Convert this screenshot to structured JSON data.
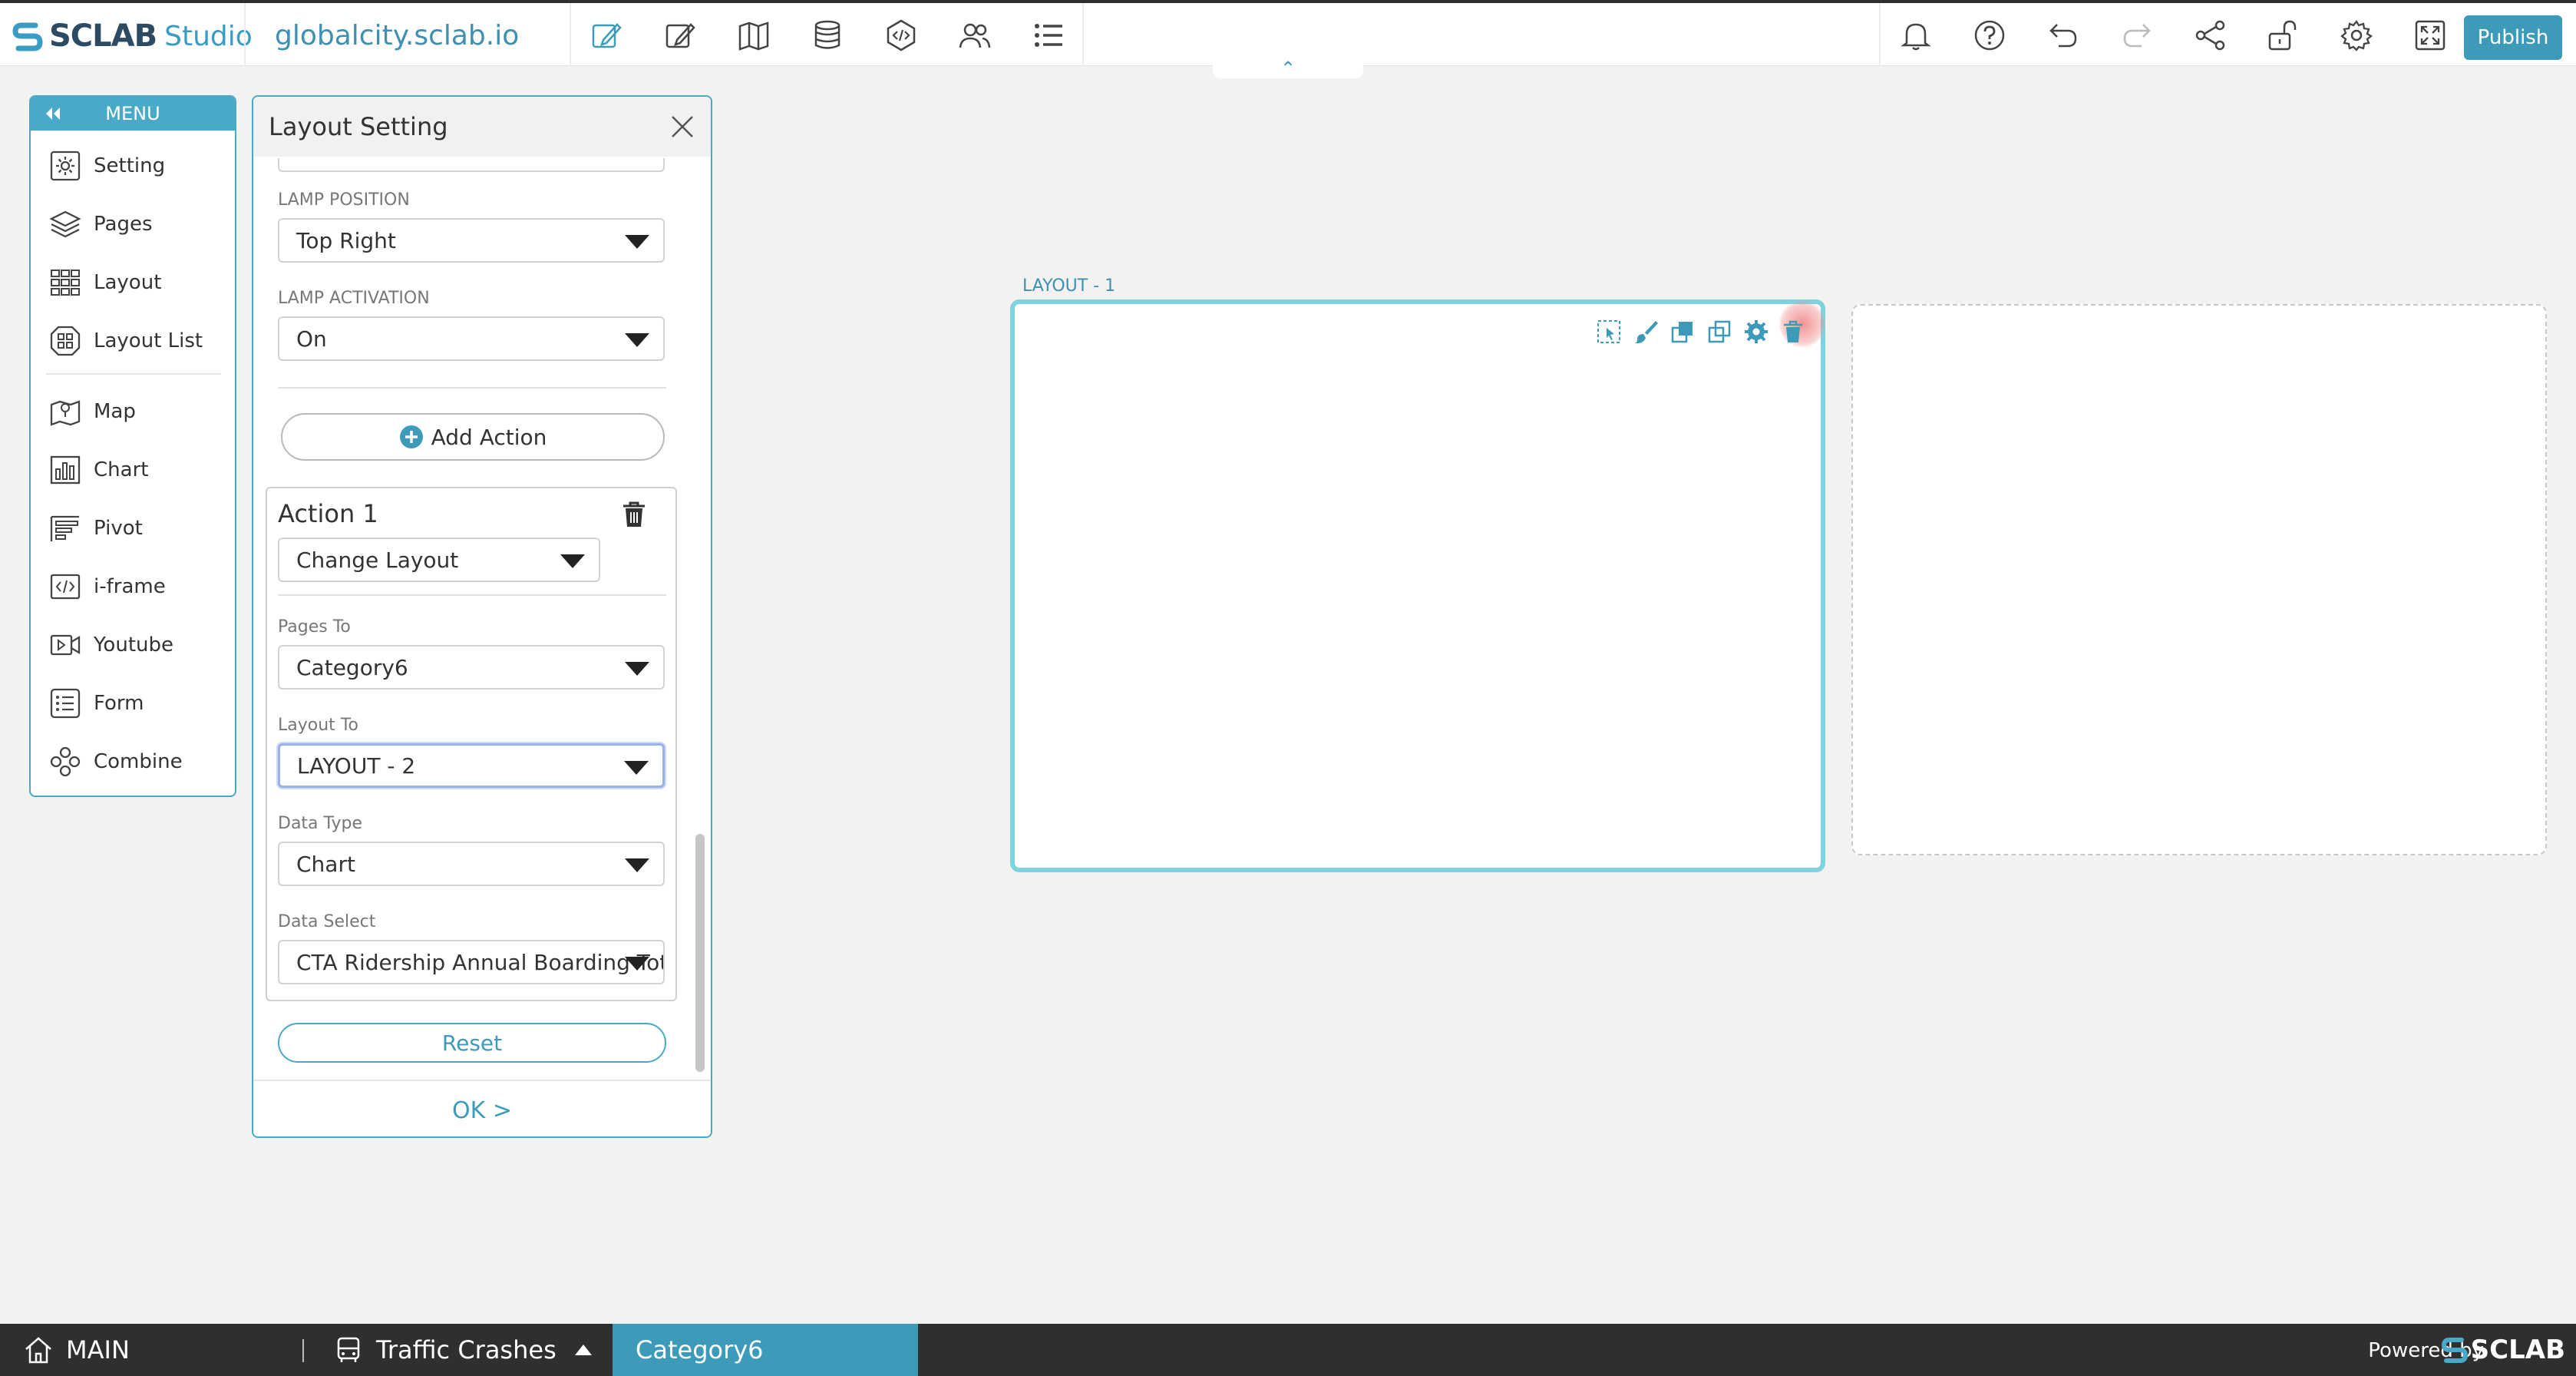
{
  "header": {
    "logo_text": "SCLAB",
    "logo_sub": "Studio",
    "domain": "globalcity.sclab.io",
    "publish_label": "Publish",
    "toolbar_icons": [
      "edit-icon",
      "note-icon",
      "map-book-icon",
      "database-icon",
      "code-icon",
      "users-icon",
      "list-icon"
    ],
    "right_icons": [
      "bell-icon",
      "help-icon",
      "undo-icon",
      "redo-icon",
      "share-icon",
      "unlock-icon",
      "gear-icon",
      "fullscreen-icon"
    ],
    "collapse_glyph": "⌃"
  },
  "menu": {
    "title": "MENU",
    "items": [
      {
        "label": "Setting",
        "icon": "gear-square-icon"
      },
      {
        "label": "Pages",
        "icon": "layers-icon"
      },
      {
        "label": "Layout",
        "icon": "grid-icon"
      },
      {
        "label": "Layout List",
        "icon": "layout-list-icon"
      },
      {
        "label": "Map",
        "icon": "map-icon"
      },
      {
        "label": "Chart",
        "icon": "bar-chart-icon"
      },
      {
        "label": "Pivot",
        "icon": "pivot-icon"
      },
      {
        "label": "i-frame",
        "icon": "code-frame-icon"
      },
      {
        "label": "Youtube",
        "icon": "video-icon"
      },
      {
        "label": "Form",
        "icon": "form-icon"
      },
      {
        "label": "Combine",
        "icon": "combine-icon"
      }
    ]
  },
  "panel": {
    "title": "Layout Setting",
    "lamp_position_label": "LAMP POSITION",
    "lamp_position_value": "Top Right",
    "lamp_activation_label": "LAMP ACTIVATION",
    "lamp_activation_value": "On",
    "add_action_label": "Add Action",
    "action": {
      "title": "Action 1",
      "type_value": "Change Layout",
      "pages_to_label": "Pages To",
      "pages_to_value": "Category6",
      "layout_to_label": "Layout To",
      "layout_to_value": "LAYOUT - 2",
      "data_type_label": "Data Type",
      "data_type_value": "Chart",
      "data_select_label": "Data Select",
      "data_select_value": "CTA Ridership Annual Boarding Tot"
    },
    "reset_label": "Reset",
    "ok_label": "OK >"
  },
  "canvas": {
    "layout1_label": "LAYOUT - 1",
    "layout1_tools": [
      "select-area-icon",
      "brush-icon",
      "bring-front-icon",
      "send-back-icon",
      "settings-icon",
      "delete-icon"
    ]
  },
  "bottombar": {
    "main_label": "MAIN",
    "page_label": "Traffic Crashes",
    "active_label": "Category6",
    "powered_label": "Powered by",
    "brand": "SCLAB"
  },
  "colors": {
    "accent": "#49a9c6",
    "layout_border": "#7fd3de",
    "bottom_bar": "#2f2f2f"
  }
}
